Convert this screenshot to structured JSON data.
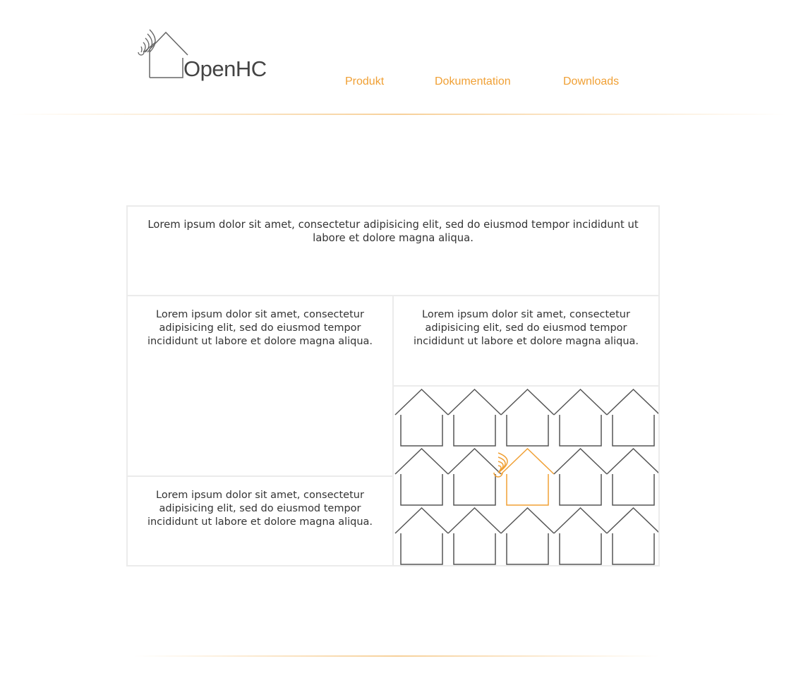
{
  "brand": {
    "name": "OpenHC"
  },
  "nav": {
    "items": [
      "Produkt",
      "Dokumentation",
      "Downloads"
    ]
  },
  "content": {
    "box1": "Lorem ipsum dolor sit amet, consectetur adipisicing elit, sed do eiusmod tempor incididunt ut labore et dolore magna aliqua.",
    "box2": "Lorem ipsum dolor sit amet, consectetur adipisicing elit, sed do eiusmod tempor incididunt ut labore et dolore magna aliqua.",
    "box3": "Lorem ipsum dolor sit amet, consectetur adipisicing elit, sed do eiusmod tempor incididunt ut labore et dolore magna aliqua.",
    "box4": "Lorem ipsum dolor sit amet, consectetur adipisicing elit, sed do eiusmod tempor incididunt ut labore et dolore magna aliqua."
  },
  "colors": {
    "accent": "#f0a035",
    "line": "#555555",
    "border": "#ebebeb"
  },
  "icons": {
    "logo": "house-wifi-icon",
    "pattern": "house-pattern",
    "highlight": "house-wifi-icon"
  }
}
